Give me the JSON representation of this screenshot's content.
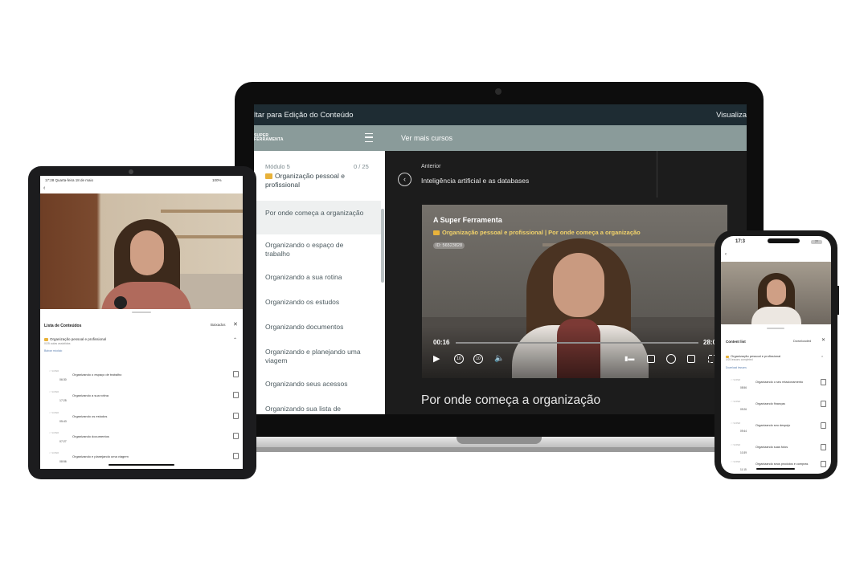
{
  "laptop": {
    "topbar": {
      "back_label": "ltar para Edição do Conteúdo",
      "right_label": "Visualiza"
    },
    "sidebar": {
      "logo_line1": "SUPER",
      "logo_line2": "FERRAMENTA",
      "module_label": "Módulo 5",
      "module_count": "0 / 25",
      "module_title": "Organização pessoal e profissional",
      "lessons": [
        "Por onde começa a organização",
        "Organizando o espaço de trabalho",
        "Organizando a sua rotina",
        "Organizando os estudos",
        "Organizando documentos",
        "Organizando e planejando uma viagem",
        "Organizando seus acessos",
        "Organizando sua lista de"
      ]
    },
    "header": {
      "more_courses": "Ver mais cursos"
    },
    "previous": {
      "label": "Anterior",
      "title": "Inteligência artificial e as databases"
    },
    "video": {
      "brand": "A Super Ferramenta",
      "course": "Organização pessoal e profissional | Por onde começa a organização",
      "id": "ID: 56523828",
      "current_time": "00:16",
      "duration": "28:0",
      "rewind_label": "10",
      "forward_label": "10"
    },
    "lesson_title": "Por onde começa a organização"
  },
  "tablet": {
    "status_left": "17:28  Quarta-feira 18 de maio",
    "status_right": "100%",
    "list_title": "Lista de Conteúdos",
    "download_label": "Baixados",
    "course_title": "Organização pessoal e profissional",
    "course_sub": "0/25 aulas assistidas",
    "link_label": "Baixar módulo",
    "items": [
      {
        "name": "Organizando o espaço de trabalho",
        "time": "06:30"
      },
      {
        "name": "Organizando a sua rotina",
        "time": "17:25"
      },
      {
        "name": "Organizando os estudos",
        "time": "05:43"
      },
      {
        "name": "Organizando documentos",
        "time": "07:27"
      },
      {
        "name": "Organizando e planejando uma viagem",
        "time": "08:56"
      }
    ]
  },
  "phone": {
    "time": "17:3",
    "battery": "77",
    "list_title": "Content list",
    "download_label": "Downloaded",
    "course_title": "Organização pessoal e profissional",
    "course_sub": "0/25 lessons completed",
    "link_label": "Download lessons",
    "items": [
      {
        "name": "Organizando o seu relacionamento",
        "time": "08:56"
      },
      {
        "name": "Organizando finanças",
        "time": "09:26"
      },
      {
        "name": "Organizando seu despejo",
        "time": "09:44"
      },
      {
        "name": "Organizando suas fotos",
        "time": "10:39"
      },
      {
        "name": "Organizando seus produtos e compras",
        "time": "11:15"
      }
    ]
  },
  "colors": {
    "topbar": "#1e2c33",
    "header": "#8a9b9a",
    "accent_yellow": "#f3d36a",
    "dark_bg": "#1c1c1c"
  },
  "icons": [
    "folder-icon",
    "menu-icon",
    "chevron-left-icon",
    "play-icon",
    "rewind-icon",
    "forward-icon",
    "volume-icon",
    "close-icon",
    "document-icon"
  ]
}
